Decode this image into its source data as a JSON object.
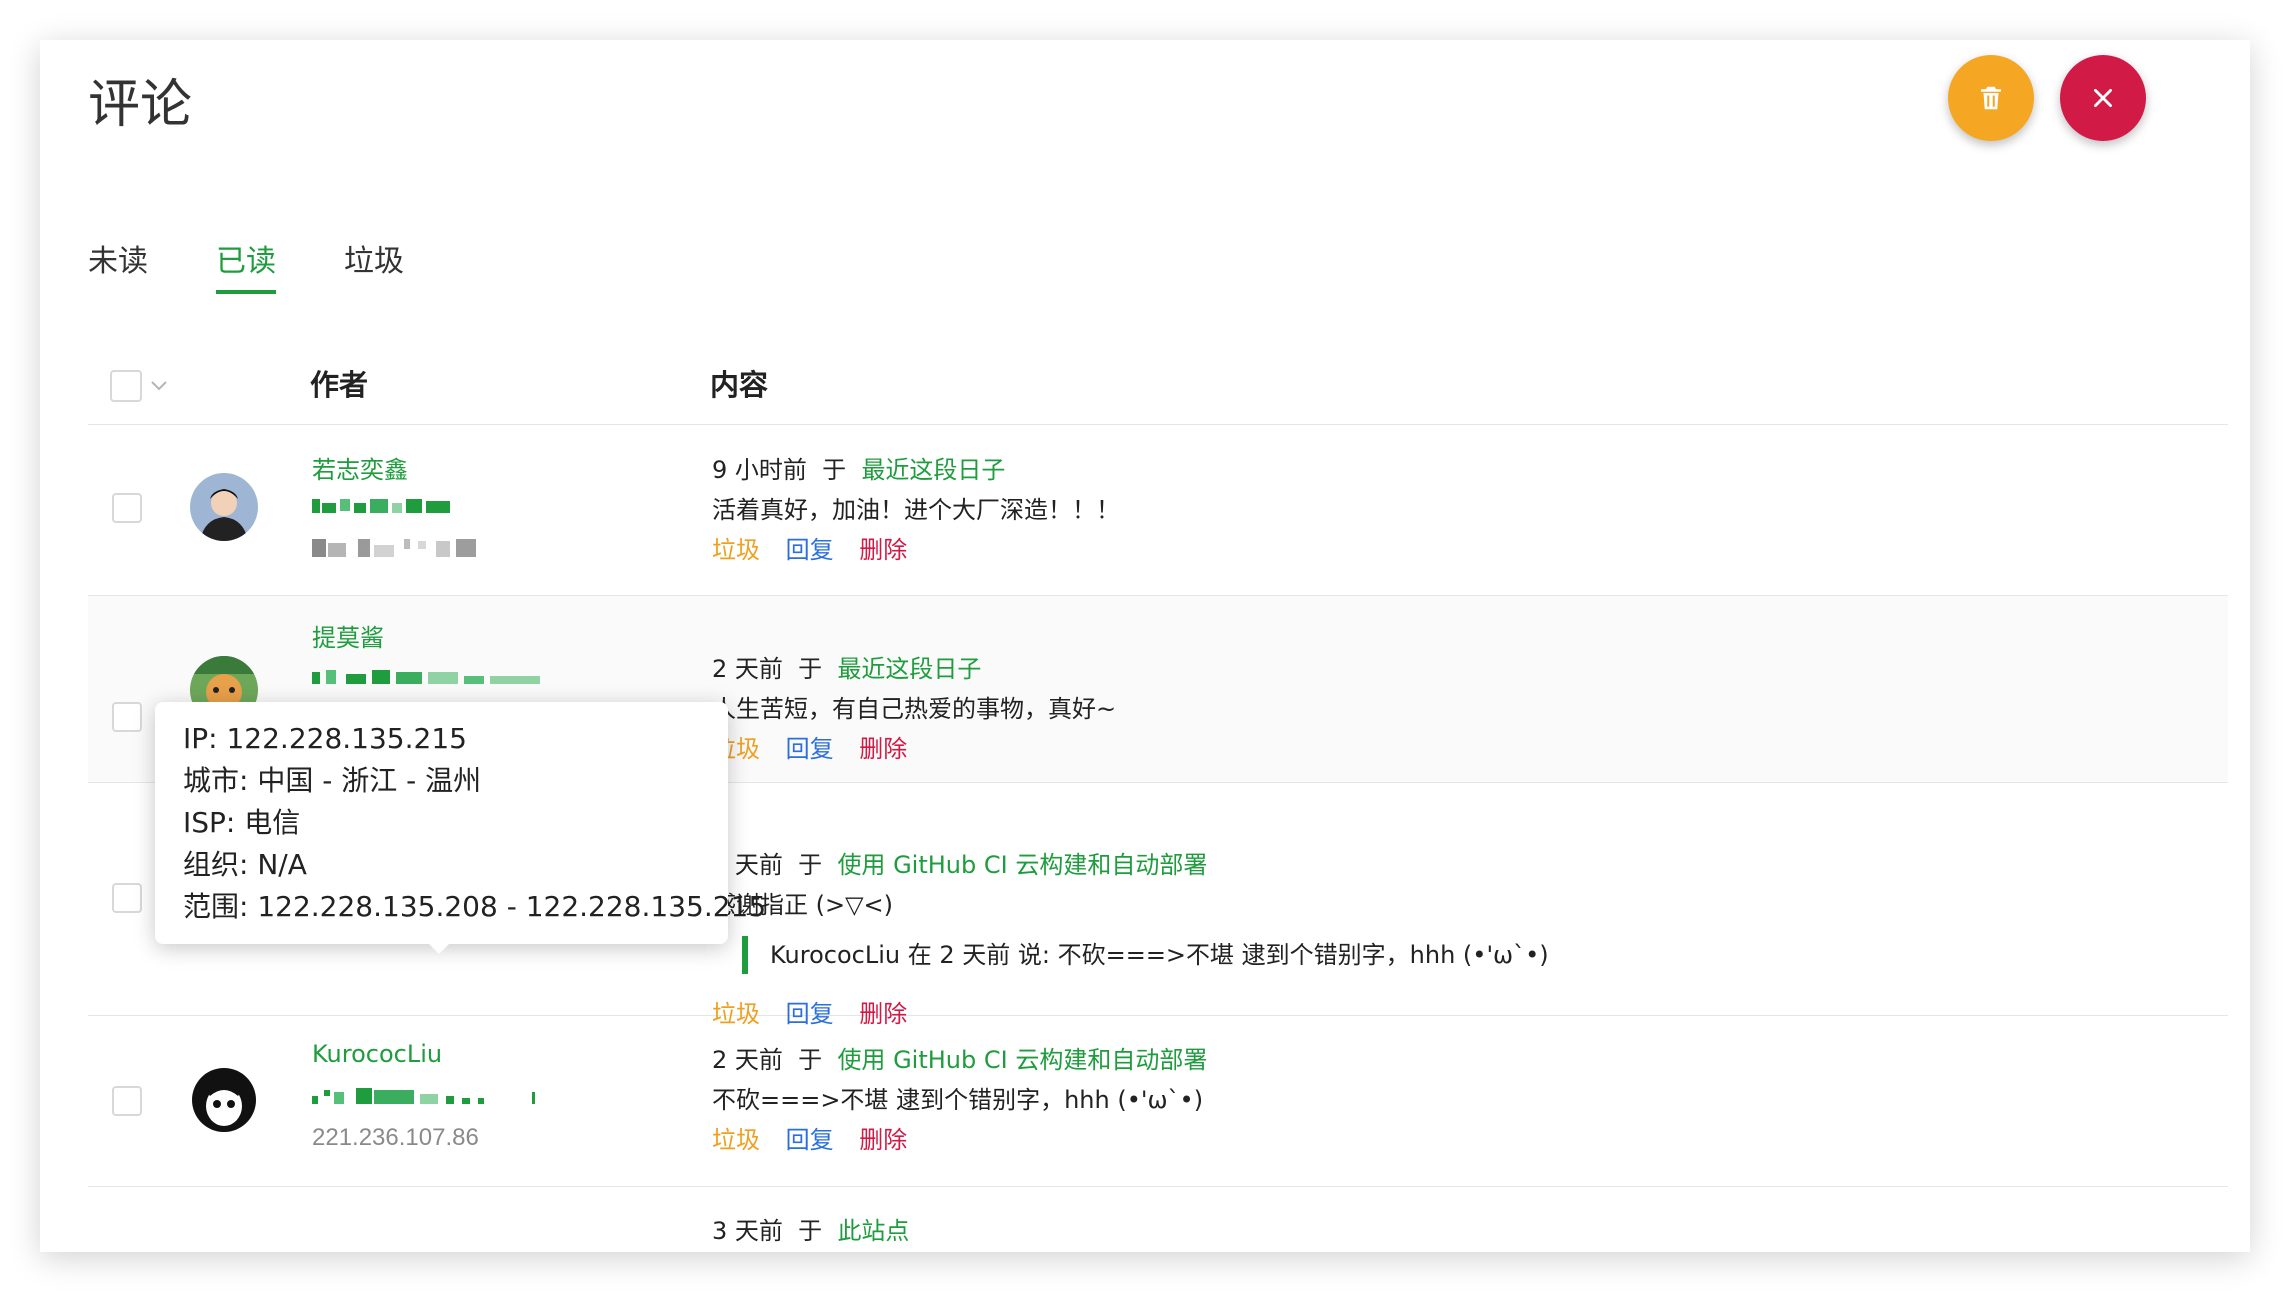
{
  "header": {
    "title": "评论"
  },
  "fab": {
    "trash_icon": "trash-icon",
    "close_icon": "close-icon"
  },
  "tabs": [
    {
      "label": "未读"
    },
    {
      "label": "已读"
    },
    {
      "label": "垃圾"
    }
  ],
  "active_tab": "已读",
  "table": {
    "col_author": "作者",
    "col_content": "内容"
  },
  "actions": {
    "spam": "垃圾",
    "reply": "回复",
    "delete": "删除"
  },
  "connector": "于",
  "comments": [
    {
      "author": "若志奕鑫",
      "ip": "",
      "time": "9 小时前",
      "post": "最近这段日子",
      "text": "活着真好，加油！进个大厂深造！！！"
    },
    {
      "author": "提莫酱",
      "ip": "",
      "time": "2 天前",
      "post": "最近这段日子",
      "text": "人生苦短，有自己热爱的事物，真好~"
    },
    {
      "author": "",
      "ip": "122.228.135.215",
      "time": "2 天前",
      "post": "使用 GitHub CI 云构建和自动部署",
      "text": "感谢指正 (>▽<)",
      "quote": "KurococLiu 在 2 天前 说: 不砍===>不堪 逮到个错别字，hhh (•'ω`•)"
    },
    {
      "author": "KurococLiu",
      "ip": "221.236.107.86",
      "time": "2 天前",
      "post": "使用 GitHub CI 云构建和自动部署",
      "text": "不砍===>不堪 逮到个错别字，hhh (•'ω`•)"
    },
    {
      "time": "3 天前",
      "post": "此站点"
    }
  ],
  "tooltip": {
    "ip": "IP: 122.228.135.215",
    "city": "城市: 中国 - 浙江 - 温州",
    "isp": "ISP: 电信",
    "org": "组织: N/A",
    "range": "范围: 122.228.135.208 - 122.228.135.215"
  },
  "colors": {
    "accent": "#1f9d3e",
    "trash_fab": "#f5a623",
    "close_fab": "#d11a46",
    "spam": "#f0a020",
    "reply": "#2a6fdb",
    "delete": "#d11a46"
  }
}
